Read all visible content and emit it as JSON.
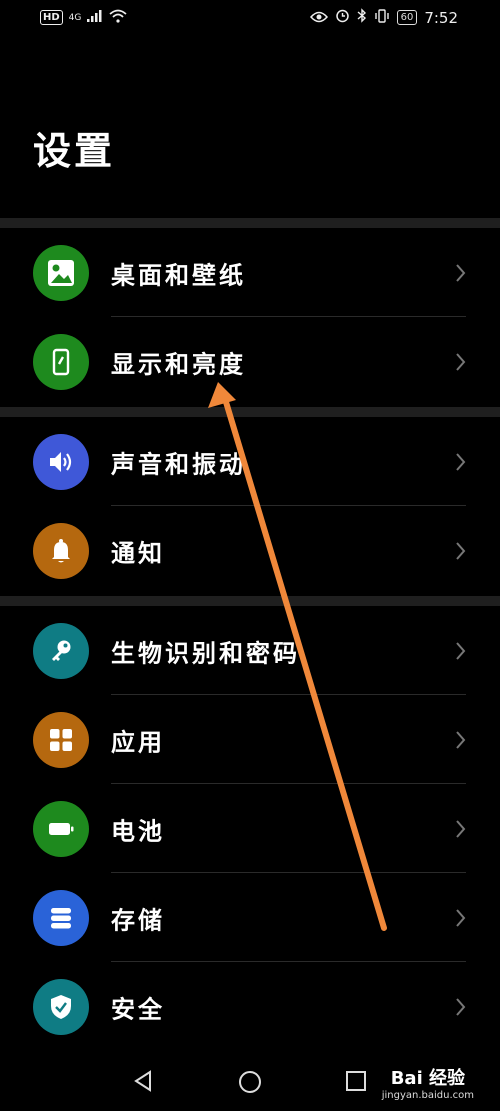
{
  "status_bar": {
    "hd": "HD",
    "network": "4G",
    "battery": "60",
    "time": "7:52"
  },
  "page": {
    "title": "设置"
  },
  "groups": [
    {
      "items": [
        {
          "label": "桌面和壁纸",
          "icon": "wallpaper-icon",
          "color": "#1e8a1e"
        },
        {
          "label": "显示和亮度",
          "icon": "display-icon",
          "color": "#1e8a1e"
        }
      ]
    },
    {
      "items": [
        {
          "label": "声音和振动",
          "icon": "speaker-icon",
          "color": "#3f58d8"
        },
        {
          "label": "通知",
          "icon": "bell-icon",
          "color": "#b5680f"
        }
      ]
    },
    {
      "items": [
        {
          "label": "生物识别和密码",
          "icon": "key-icon",
          "color": "#0f7c84"
        },
        {
          "label": "应用",
          "icon": "apps-icon",
          "color": "#b5680f"
        },
        {
          "label": "电池",
          "icon": "battery-icon",
          "color": "#1e8a1e"
        },
        {
          "label": "存储",
          "icon": "storage-icon",
          "color": "#2a63d8"
        },
        {
          "label": "安全",
          "icon": "shield-icon",
          "color": "#0f7c84"
        }
      ]
    }
  ],
  "nav_bar": {
    "back": "back-icon",
    "home": "home-icon",
    "recents": "recents-icon"
  },
  "watermark": {
    "main": "Bai 经验",
    "sub": "jingyan.baidu.com"
  },
  "annotation": {
    "arrow_color": "#f0883a"
  }
}
